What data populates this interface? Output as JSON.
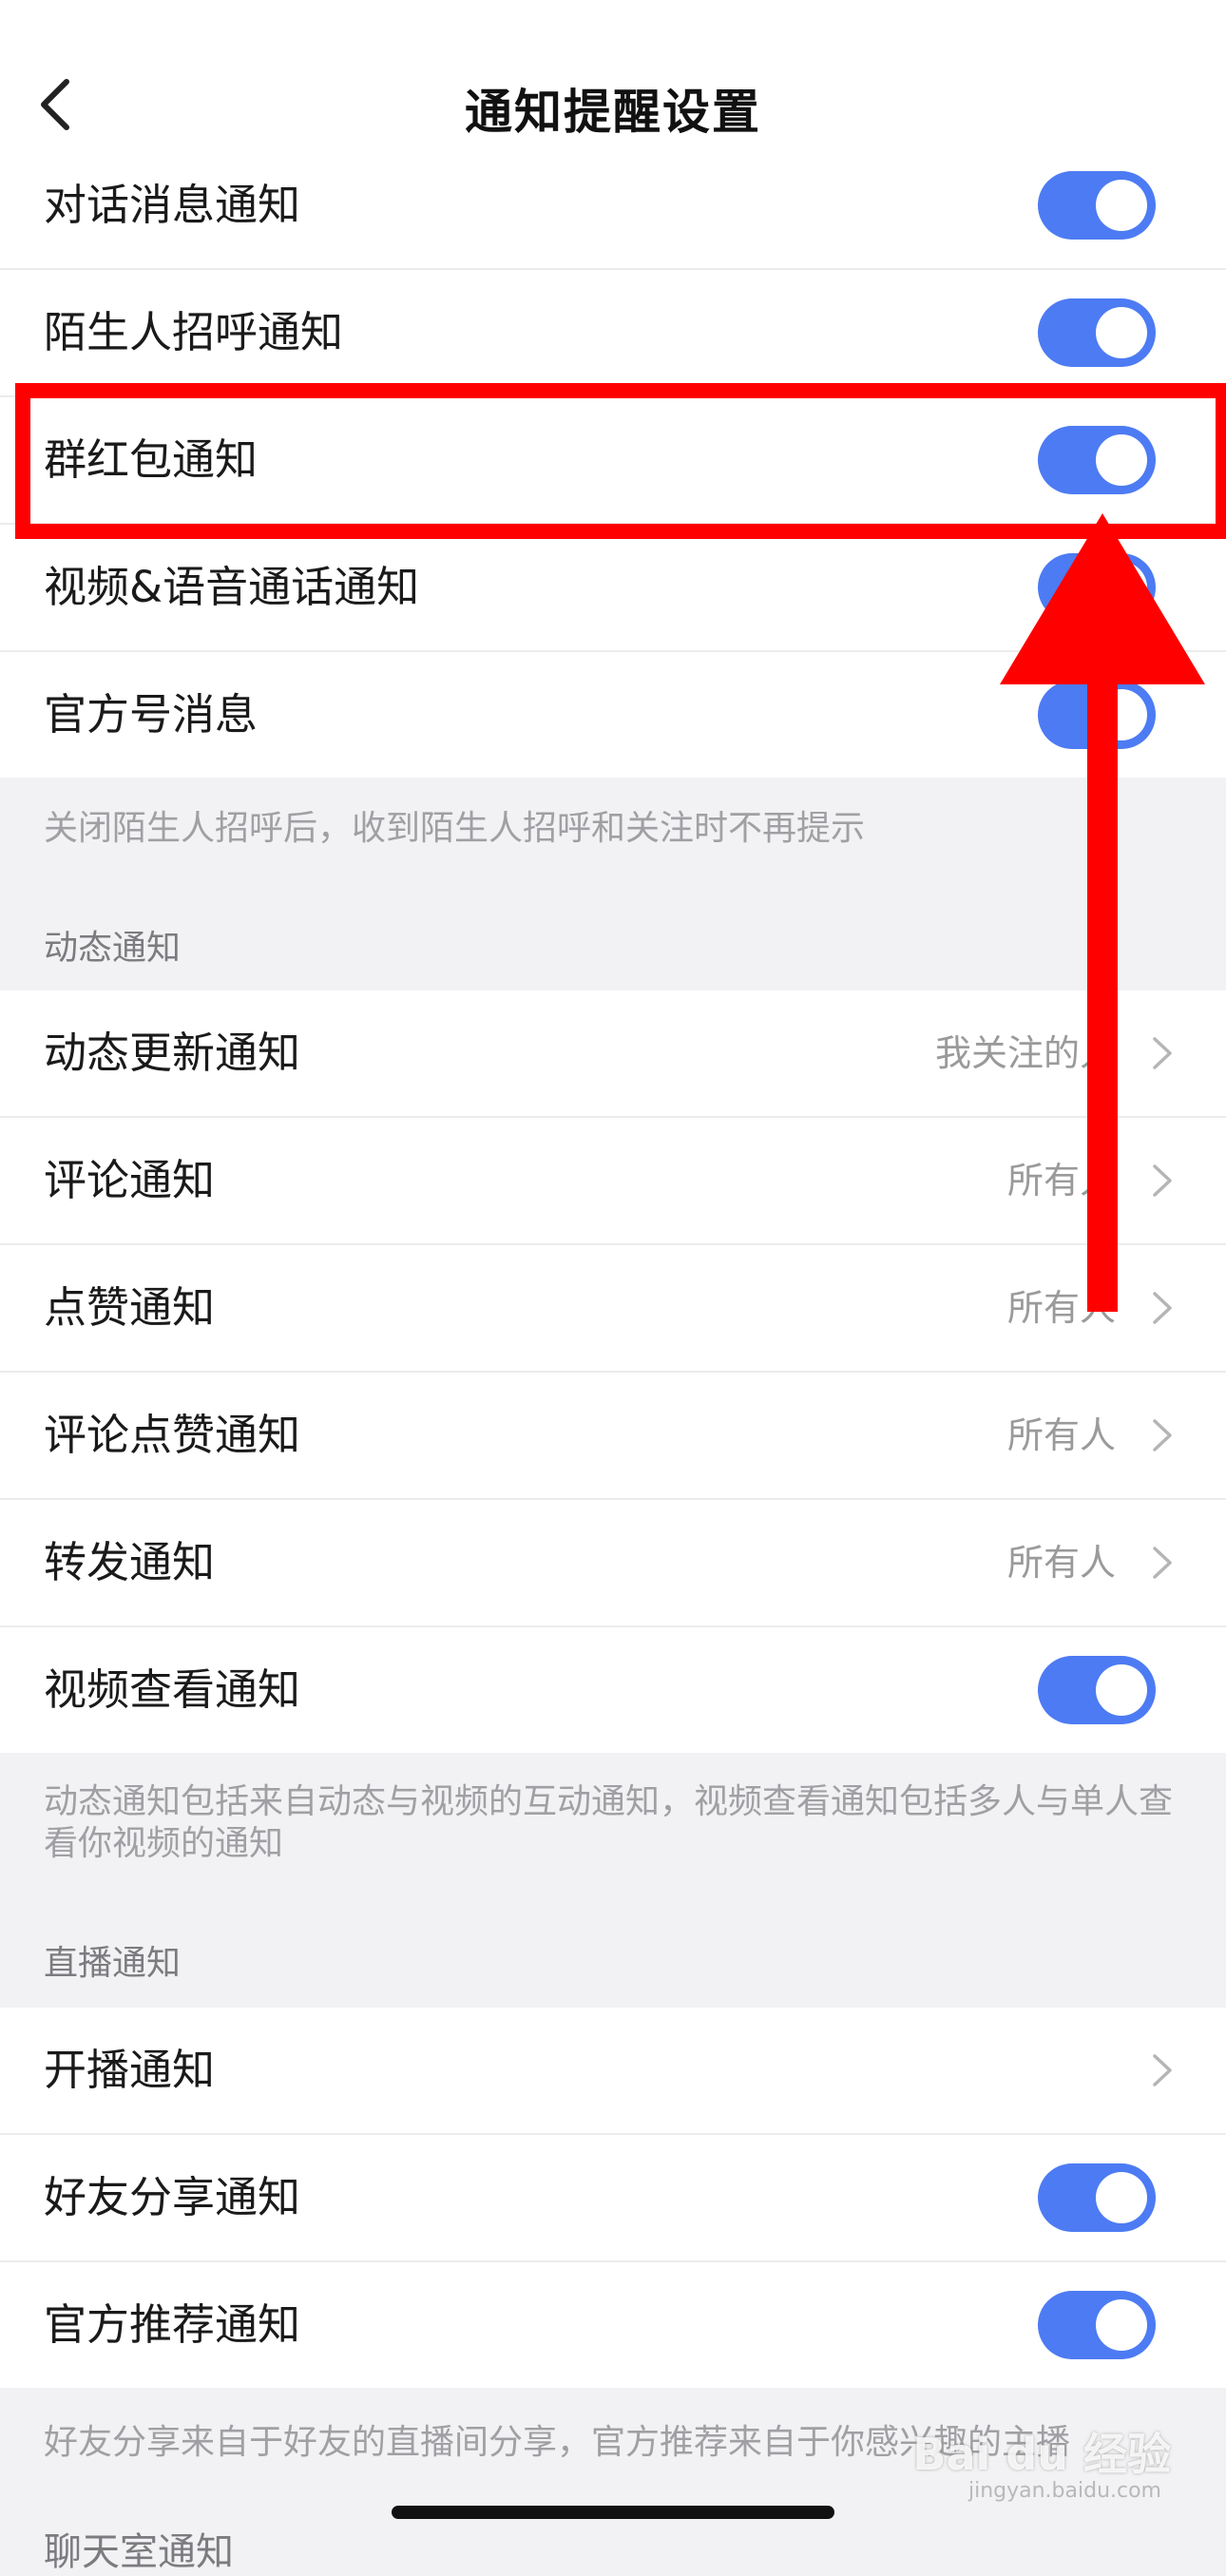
{
  "header": {
    "title": "通知提醒设置"
  },
  "chat_group": {
    "items": [
      {
        "label": "对话消息通知",
        "type": "toggle",
        "on": true
      },
      {
        "label": "陌生人招呼通知",
        "type": "toggle",
        "on": true
      },
      {
        "label": "群红包通知",
        "type": "toggle",
        "on": true
      },
      {
        "label": "视频&语音通话通知",
        "type": "toggle",
        "on": true
      },
      {
        "label": "官方号消息",
        "type": "toggle",
        "on": true
      }
    ],
    "note": "关闭陌生人招呼后，收到陌生人招呼和关注时不再提示"
  },
  "dynamic_group": {
    "header": "动态通知",
    "items": [
      {
        "label": "动态更新通知",
        "type": "select",
        "value": "我关注的人"
      },
      {
        "label": "评论通知",
        "type": "select",
        "value": "所有人"
      },
      {
        "label": "点赞通知",
        "type": "select",
        "value": "所有人"
      },
      {
        "label": "评论点赞通知",
        "type": "select",
        "value": "所有人"
      },
      {
        "label": "转发通知",
        "type": "select",
        "value": "所有人"
      },
      {
        "label": "视频查看通知",
        "type": "toggle",
        "on": true
      }
    ],
    "note": "动态通知包括来自动态与视频的互动通知，视频查看通知包括多人与单人查看你视频的通知"
  },
  "live_group": {
    "header": "直播通知",
    "items": [
      {
        "label": "开播通知",
        "type": "link"
      },
      {
        "label": "好友分享通知",
        "type": "toggle",
        "on": true
      },
      {
        "label": "官方推荐通知",
        "type": "toggle",
        "on": true
      }
    ],
    "note": "好友分享来自于好友的直播间分享，官方推荐来自于你感兴趣的主播"
  },
  "next_section_header_partial": "聊天室通知",
  "watermark": {
    "text": "Bai du 经验",
    "sub": "jingyan.baidu.com"
  },
  "colors": {
    "toggle_on": "#4d7bf3",
    "annotation_red": "#ff0000",
    "background_gray": "#f2f2f4"
  },
  "icons": {
    "back": "chevron-left-icon",
    "row_arrow": "chevron-right-icon"
  }
}
